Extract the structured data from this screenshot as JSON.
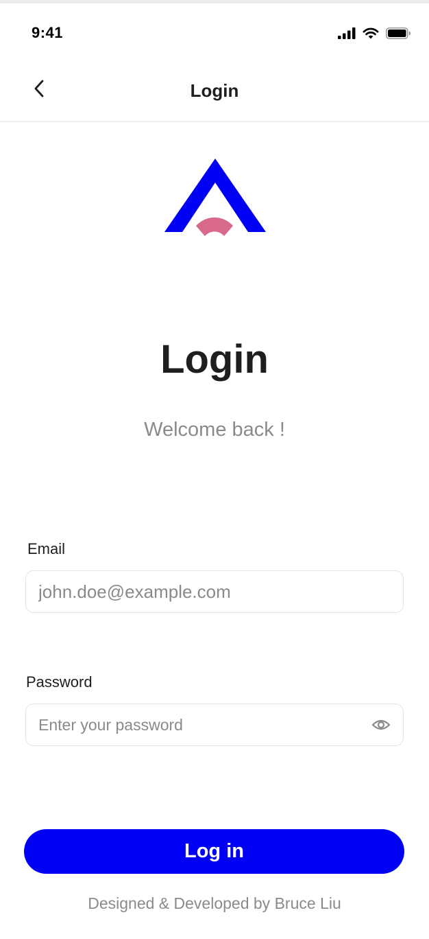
{
  "status_bar": {
    "time": "9:41",
    "icons": [
      "cellular-signal-icon",
      "wifi-icon",
      "battery-icon"
    ]
  },
  "nav": {
    "back_icon": "chevron-left-icon",
    "title": "Login"
  },
  "logo": {
    "icon": "app-logo",
    "colors": {
      "triangle": "#0000f5",
      "arc": "#d9698a"
    }
  },
  "header": {
    "title": "Login",
    "subtitle": "Welcome back !"
  },
  "form": {
    "email": {
      "label": "Email",
      "value": "",
      "placeholder": "john.doe@example.com"
    },
    "password": {
      "label": "Password",
      "value": "",
      "placeholder": "Enter your password",
      "toggle_icon": "eye-icon"
    },
    "submit_label": "Log in"
  },
  "footer": {
    "credit": "Designed & Developed by Bruce Liu"
  },
  "colors": {
    "accent": "#0000f5",
    "text_primary": "#1e1e1e",
    "text_muted": "#8a8a8a",
    "border": "#e4e4e4"
  }
}
